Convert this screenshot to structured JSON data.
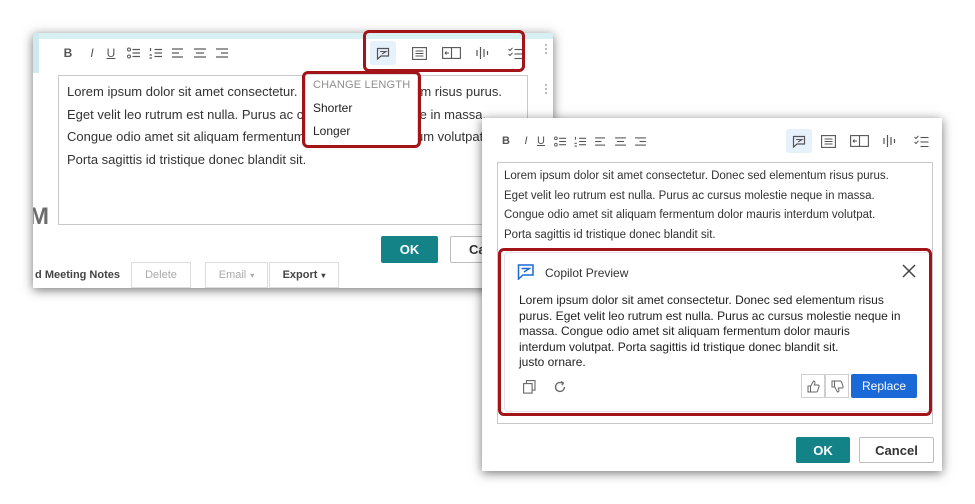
{
  "back_dialog": {
    "toolbar": {
      "bold": "B",
      "italic": "I",
      "underline": "U"
    },
    "editor_lines": [
      "Lorem ipsum dolor sit amet consectetur. Donec sed elementum risus purus.",
      "Eget velit leo rutrum est nulla. Purus ac cursus molestie neque in massa.",
      "Congue odio amet sit aliquam fermentum dolor mauris interdum volutpat.",
      "Porta sagittis id tristique donec blandit sit."
    ],
    "side_letter": "M",
    "ok_label": "OK",
    "cancel_label": "Ca",
    "footer": {
      "notes_label": "d Meeting Notes",
      "delete_label": "Delete",
      "email_label": "Email",
      "export_label": "Export"
    }
  },
  "change_length_menu": {
    "header": "CHANGE LENGTH",
    "items": [
      "Shorter",
      "Longer"
    ]
  },
  "front_dialog": {
    "toolbar": {
      "bold": "B",
      "italic": "I",
      "underline": "U"
    },
    "editor_lines": [
      "Lorem ipsum dolor sit amet consectetur. Donec sed elementum risus purus.",
      "Eget velit leo rutrum est nulla. Purus ac cursus molestie neque in massa.",
      "Congue odio amet sit aliquam fermentum dolor mauris interdum volutpat.",
      "Porta sagittis id tristique donec blandit sit."
    ],
    "copilot": {
      "title": "Copilot Preview",
      "text": "Lorem ipsum dolor sit amet consectetur. Donec sed elementum risus\npurus. Eget velit leo rutrum est nulla. Purus ac cursus molestie neque in\nmassa. Congue odio amet sit aliquam fermentum dolor mauris\ninterdum volutpat. Porta sagittis id tristique donec blandit sit.\n justo ornare.",
      "replace_label": "Replace"
    },
    "ok_label": "OK",
    "cancel_label": "Cancel"
  },
  "colors": {
    "highlight": "#a31419",
    "ok_button": "#138388",
    "replace_button": "#1a69d6",
    "active_tool": "#e6f1fb",
    "copilot_icon": "#1a69d6"
  },
  "icons": {
    "tool_group": [
      "copilot-icon",
      "summarize-icon",
      "change-length-icon",
      "tone-icon",
      "checklist-icon"
    ],
    "copilot_actions": [
      "copy-icon",
      "regenerate-icon",
      "thumbs-up-icon",
      "thumbs-down-icon",
      "close-icon"
    ]
  }
}
